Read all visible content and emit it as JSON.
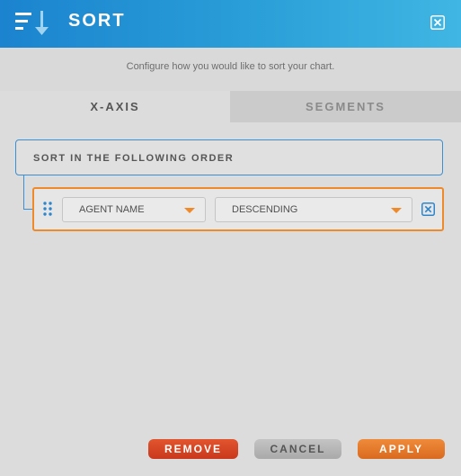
{
  "header": {
    "title": "SORT",
    "icon": "sort-descending-icon",
    "close_icon": "close-icon"
  },
  "subtitle": "Configure how you would like to sort your chart.",
  "tabs": [
    {
      "label": "X-AXIS",
      "active": true
    },
    {
      "label": "SEGMENTS",
      "active": false
    }
  ],
  "order_section": {
    "label": "SORT IN THE FOLLOWING ORDER"
  },
  "sort_rules": [
    {
      "field": "AGENT NAME",
      "direction": "DESCENDING"
    }
  ],
  "buttons": {
    "remove": "REMOVE",
    "cancel": "CANCEL",
    "apply": "APPLY"
  },
  "colors": {
    "header": "#1b83cf",
    "accent": "#ee8a2a",
    "remove": "#d7452a",
    "apply": "#e57a2c",
    "border_blue": "#3c8fd0"
  }
}
